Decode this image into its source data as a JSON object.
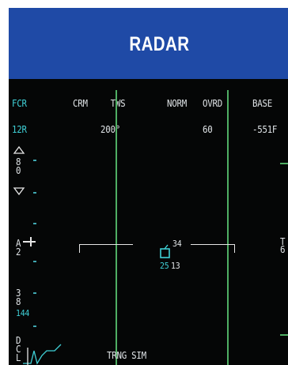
{
  "header": {
    "title": "RADAR"
  },
  "osb_top": {
    "fcr": {
      "line1": "FCR",
      "line2": "12R"
    },
    "crm": {
      "line1": "CRM",
      "line2": ""
    },
    "tws": {
      "line1": "TWS",
      "line2": "200°"
    },
    "norm": {
      "line1": "NORM",
      "line2": ""
    },
    "ovrd": {
      "line1": "OVRD",
      "line2": "60"
    },
    "base": {
      "line1": "BASE",
      "line2": "-551F"
    }
  },
  "left_scale": {
    "range_label": "8\n0",
    "az_label": "A\n2",
    "bar_label": "3\n8",
    "bottom_value": "144",
    "dcpl_label": "D\nC\nL"
  },
  "target": {
    "top_label": "34",
    "bottom_left": "25",
    "bottom_right": "13"
  },
  "right_edge": {
    "t_label": "T",
    "t_sub": "6"
  },
  "footer": {
    "mode_label": "TRNG SIM"
  },
  "colors": {
    "header_bg": "#1f4aa6",
    "scope_bg": "#050606",
    "symbology_cyan": "#3fd0d6",
    "gridline_green": "#4fae63",
    "text_white": "#dfe3e6"
  }
}
